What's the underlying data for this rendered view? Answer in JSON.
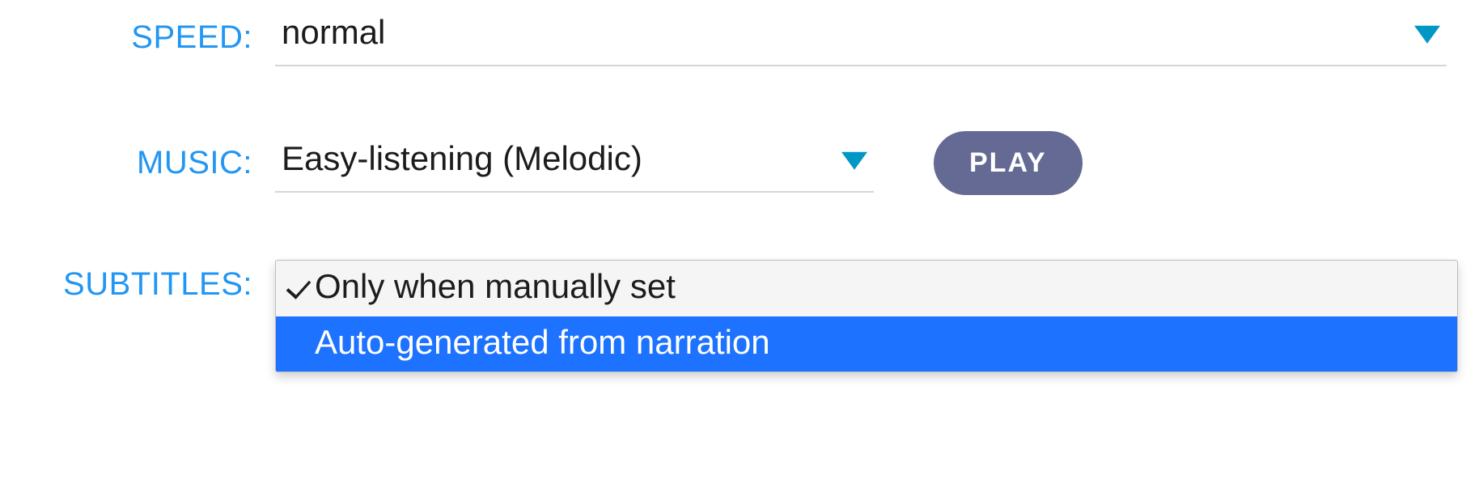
{
  "speed": {
    "label": "SPEED:",
    "value": "normal"
  },
  "music": {
    "label": "MUSIC:",
    "value": "Easy-listening (Melodic)",
    "play_label": "PLAY"
  },
  "subtitles": {
    "label": "SUBTITLES:",
    "options": [
      {
        "text": "Only when manually set",
        "selected": true,
        "highlighted": false
      },
      {
        "text": "Auto-generated from narration",
        "selected": false,
        "highlighted": true
      }
    ]
  }
}
